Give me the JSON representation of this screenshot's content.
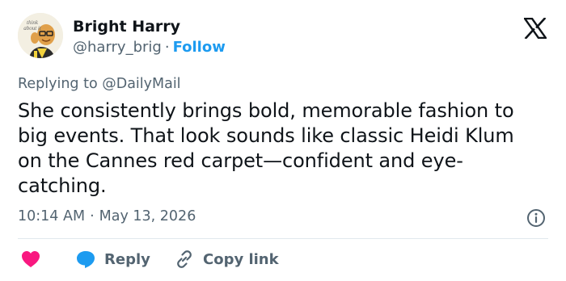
{
  "author": {
    "display_name": "Bright Harry",
    "handle": "@harry_brig",
    "separator": "·",
    "follow_label": "Follow",
    "avatar_caption": "think about it"
  },
  "reply_context": "Replying to @DailyMail",
  "tweet": {
    "text": "She consistently brings bold, memorable fashion to big events. That look sounds like classic Heidi Klum on the Cannes red carpet—confident and eye-catching.",
    "time": "10:14 AM",
    "date_separator": "·",
    "date": "May 13, 2026"
  },
  "actions": {
    "reply_label": "Reply",
    "copy_link_label": "Copy link"
  },
  "icons": {
    "brand": "x-logo-icon",
    "info": "info-icon",
    "like": "heart-icon",
    "reply": "reply-bubble-icon",
    "copy": "link-icon"
  },
  "colors": {
    "accent": "#1d9bf0",
    "like": "#f91880",
    "text": "#0f1419",
    "muted": "#536471"
  }
}
